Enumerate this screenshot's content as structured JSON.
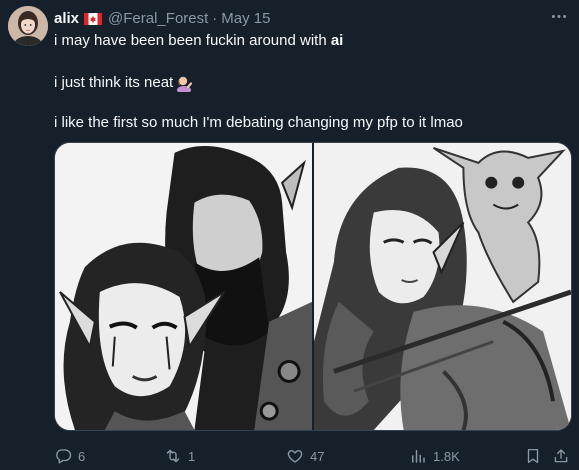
{
  "tweet": {
    "author_name": "alix",
    "flag_icon": "canada-flag-icon",
    "handle": "@Feral_Forest",
    "separator": "·",
    "date": "May 15",
    "line1_prefix": "i may have been been fuckin around with ",
    "line1_bold": "ai",
    "line2": "i just think its neat",
    "line2_emoji": "person-tipping-hand-emoji",
    "line3": "i like the first so much I'm debating changing my pfp to it lmao"
  },
  "media": {
    "images": [
      {
        "subject": "elf-woman-and-bearded-warrior-sketch"
      },
      {
        "subject": "elf-archer-with-goblin-sketch"
      }
    ]
  },
  "actions": {
    "replies": "6",
    "reposts": "1",
    "likes": "47",
    "views": "1.8K"
  },
  "colors": {
    "background": "#15202b",
    "text": "#f7f9f9",
    "muted": "#8b98a5",
    "border": "#38444d"
  }
}
